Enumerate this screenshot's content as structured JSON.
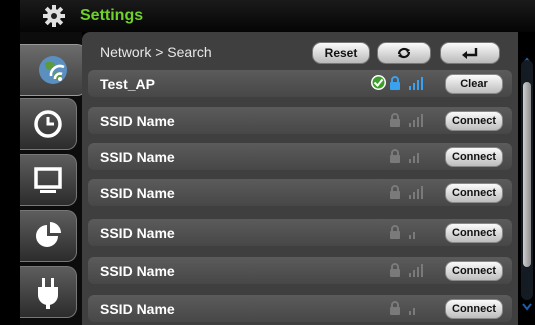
{
  "title_bar": {
    "title": "Settings",
    "icon": "gear-icon",
    "accent_color": "#6fd12a"
  },
  "sidebar": {
    "tabs": [
      {
        "icon": "network-icon",
        "active": true
      },
      {
        "icon": "clock-icon",
        "active": false
      },
      {
        "icon": "display-icon",
        "active": false
      },
      {
        "icon": "pie-chart-icon",
        "active": false
      },
      {
        "icon": "power-plug-icon",
        "active": false
      }
    ]
  },
  "header": {
    "breadcrumb": "Network > Search",
    "reset_label": "Reset",
    "refresh_icon": "refresh-icon",
    "back_icon": "back-enter-icon"
  },
  "connected": {
    "name": "Test_AP",
    "button": "Clear",
    "status_icons": [
      "check-icon",
      "lock-icon",
      "signal-icon"
    ]
  },
  "networks": [
    {
      "name": "SSID Name",
      "button": "Connect"
    },
    {
      "name": "SSID Name",
      "button": "Connect"
    },
    {
      "name": "SSID Name",
      "button": "Connect"
    },
    {
      "name": "SSID Name",
      "button": "Connect"
    },
    {
      "name": "SSID Name",
      "button": "Connect"
    },
    {
      "name": "SSID Name",
      "button": "Connect"
    }
  ]
}
